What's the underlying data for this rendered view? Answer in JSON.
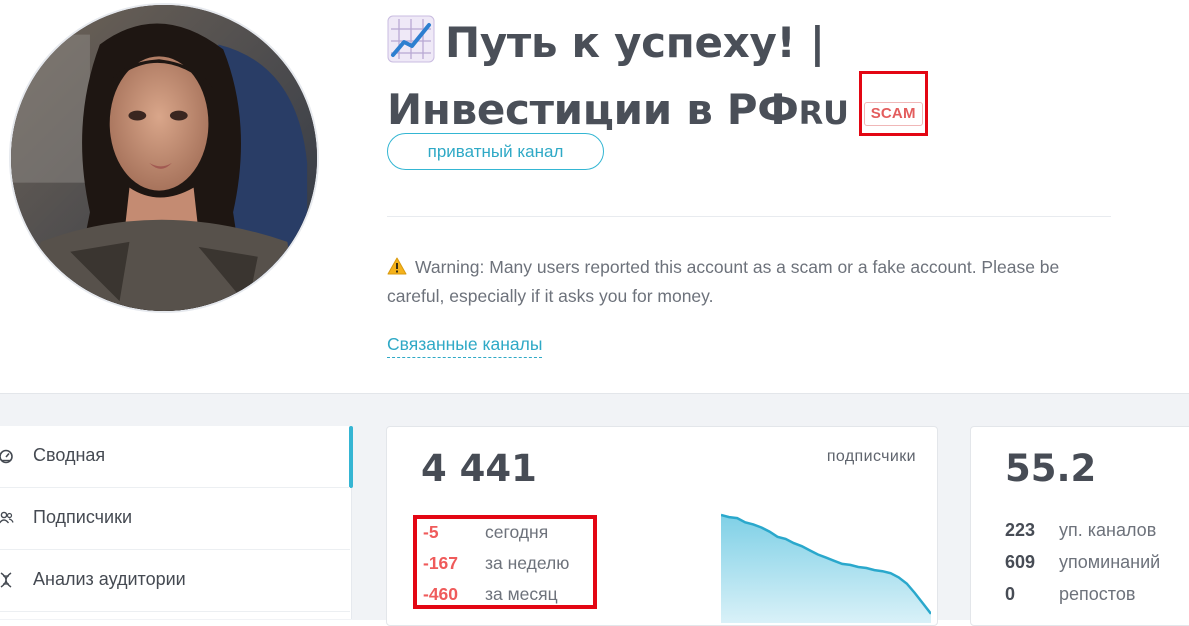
{
  "channel": {
    "title": "Путь к успеху! | Инвестиции в РФ",
    "title_suffix": "RU",
    "scam_badge": "SCAM",
    "type_pill": "приватный канал",
    "warning": "Warning: Many users reported this account as a scam or a fake account. Please be careful, especially if it asks you for money.",
    "related_link": "Связанные каналы"
  },
  "sidebar": {
    "items": [
      {
        "label": "Сводная",
        "icon": "dashboard-icon",
        "active": true
      },
      {
        "label": "Подписчики",
        "icon": "users-icon"
      },
      {
        "label": "Анализ аудитории",
        "icon": "dna-icon"
      }
    ]
  },
  "subscribers_card": {
    "value": "4 441",
    "label": "подписчики",
    "deltas": [
      {
        "value": "-5",
        "label": "сегодня"
      },
      {
        "value": "-167",
        "label": "за неделю"
      },
      {
        "value": "-460",
        "label": "за месяц"
      }
    ],
    "trend": [
      100,
      98,
      97,
      93,
      91,
      88,
      84,
      79,
      77,
      73,
      70,
      66,
      62,
      59,
      56,
      53,
      52,
      50,
      49,
      47,
      46,
      44,
      40,
      34,
      25,
      15,
      5
    ],
    "trend_color": "#2aa8cc"
  },
  "index_card": {
    "value": "55.2",
    "stats": [
      {
        "value": "223",
        "label": "уп. каналов"
      },
      {
        "value": "609",
        "label": "упоминаний"
      },
      {
        "value": "0",
        "label": "репостов"
      }
    ]
  },
  "colors": {
    "accent": "#35b5d3",
    "danger": "#ef5b5b",
    "highlight": "#e30613"
  }
}
